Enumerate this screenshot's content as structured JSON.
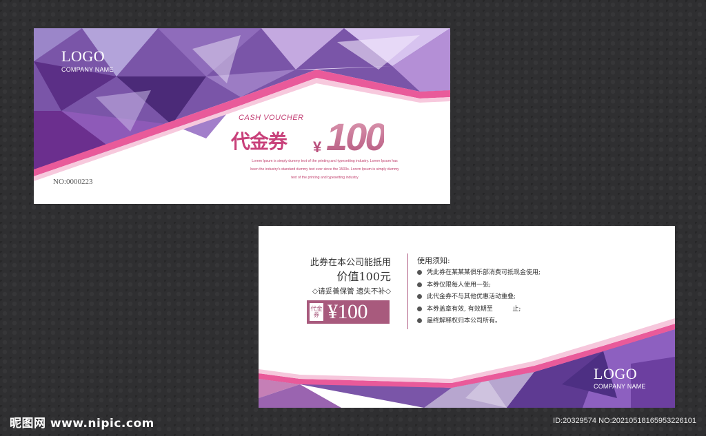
{
  "front": {
    "logo": "LOGO",
    "company": "COMPANY NAME",
    "cash_voucher": "CASH VOUCHER",
    "title": "代金券",
    "currency": "¥",
    "amount": "100",
    "lorem": [
      "Lorem Ipsum is simply dummy text of the printing and typesetting industry. Lorem Ipsum has",
      "been the industry's standard dummy text ever since the 1500s. Lorem Ipsum is simply dummy",
      "text of the printing and typesetting industry"
    ],
    "serial": "NO:0000223"
  },
  "back": {
    "statement_line1": "此券在本公司能抵用",
    "statement_line2": "价值100元",
    "keep_notice": "◇请妥善保管  遗失不补◇",
    "badge_label": "代金券",
    "badge_amount": "¥100",
    "notes_title": "使用须知:",
    "notes": [
      "凭此券在某某某俱乐部消费可抵现金使用;",
      "本券仅限每人使用一张;",
      "此代金券不与其他优惠活动重叠;",
      "本券盖章有效, 有效期至          止;",
      "最终解释权归本公司所有。"
    ],
    "logo": "LOGO",
    "company": "COMPANY NAME"
  },
  "watermark": {
    "left": "昵图网 www.nipic.com",
    "right": "ID:20329574 NO:20210518165953226101"
  },
  "colors": {
    "background": "#2f2f31",
    "accent_pink": "#c8407a",
    "accent_purple": "#6a3a9a",
    "badge": "#a85a7d"
  }
}
